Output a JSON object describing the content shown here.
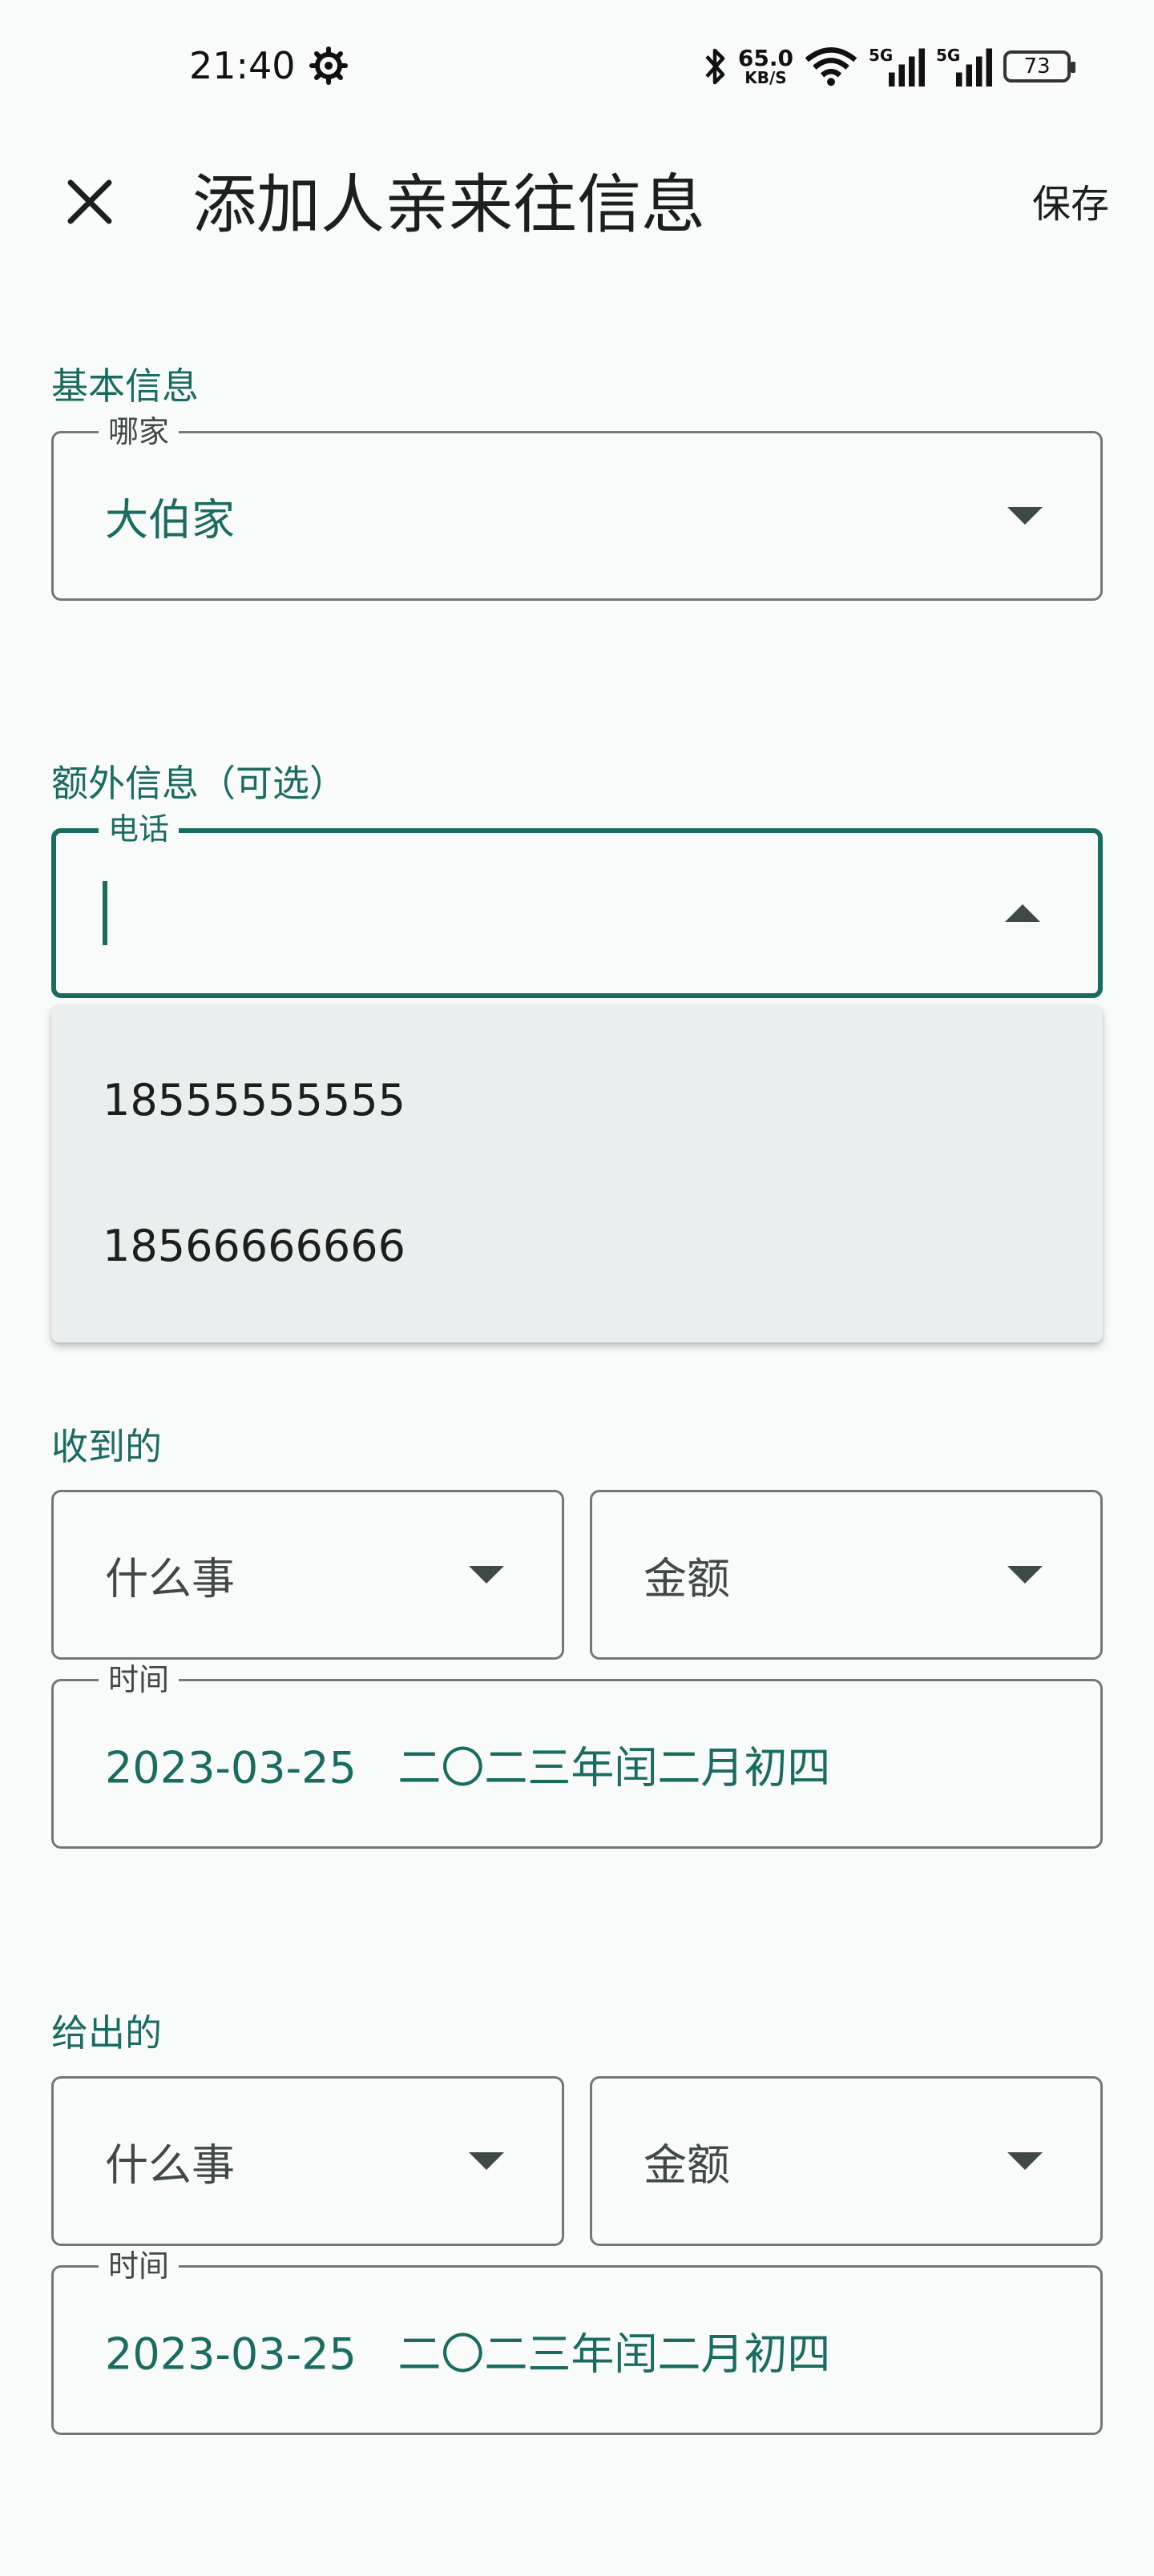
{
  "status_bar": {
    "time": "21:40",
    "net_speed_value": "65.0",
    "net_speed_unit": "KB/S",
    "signal1_label": "5G",
    "signal2_label": "5G",
    "battery": "73",
    "icons": [
      "gear-icon",
      "bluetooth-icon",
      "wifi-icon",
      "signal-icon",
      "battery-icon"
    ]
  },
  "app_bar": {
    "title": "添加人亲来往信息",
    "save_label": "保存",
    "close_icon": "close-icon"
  },
  "basic_info": {
    "header": "基本信息",
    "family_field": {
      "label": "哪家",
      "value": "大伯家"
    }
  },
  "extra_info": {
    "header": "额外信息（可选）",
    "phone_field": {
      "label": "电话",
      "value": ""
    },
    "phone_options": [
      "18555555555",
      "18566666666"
    ]
  },
  "received": {
    "header": "收到的",
    "event_placeholder": "什么事",
    "amount_placeholder": "金额",
    "time_field": {
      "label": "时间",
      "value": "2023-03-25   二〇二三年闰二月初四"
    }
  },
  "given": {
    "header": "给出的",
    "event_placeholder": "什么事",
    "amount_placeholder": "金额",
    "time_field": {
      "label": "时间",
      "value": "2023-03-25   二〇二三年闰二月初四"
    }
  },
  "colors": {
    "accent": "#1a6b60",
    "outline": "#707978",
    "menu_bg": "#e8efee",
    "background": "#f9fbfa"
  }
}
